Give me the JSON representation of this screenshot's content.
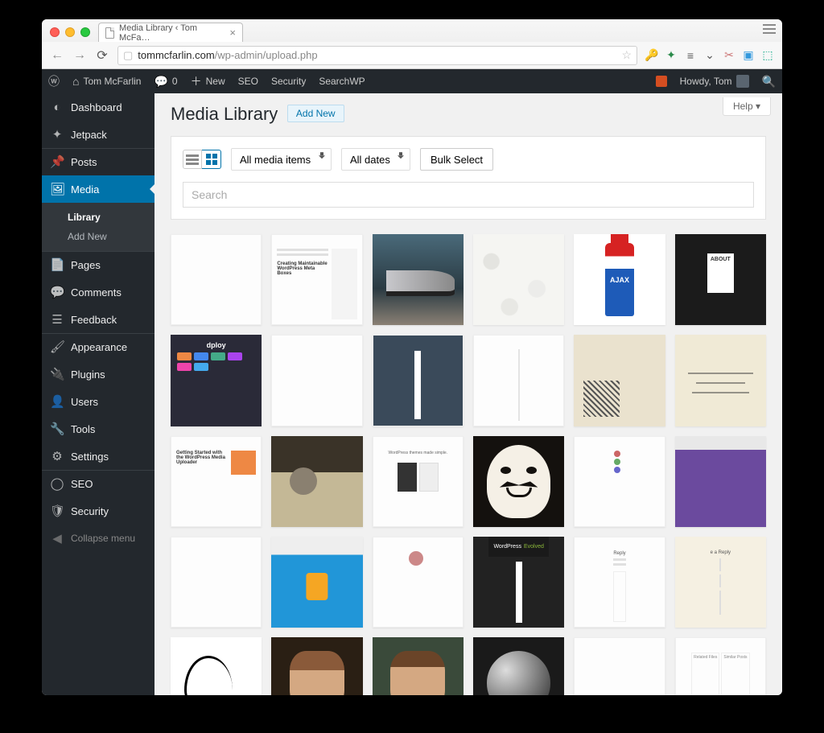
{
  "browser": {
    "tab_title": "Media Library ‹ Tom McFa…",
    "url_host": "tommcfarlin.com",
    "url_path": "/wp-admin/upload.php"
  },
  "adminbar": {
    "site_name": "Tom McFarlin",
    "comment_count": "0",
    "new_label": "New",
    "items": [
      "SEO",
      "Security",
      "SearchWP"
    ],
    "howdy": "Howdy, Tom"
  },
  "sidebar": {
    "items": [
      {
        "label": "Dashboard",
        "icon": "◐"
      },
      {
        "label": "Jetpack",
        "icon": "✦"
      },
      {
        "label": "Posts",
        "icon": "📌",
        "sep": true
      },
      {
        "label": "Media",
        "icon": "🖼",
        "current": true
      },
      {
        "label": "Pages",
        "icon": "📄",
        "sep": true
      },
      {
        "label": "Comments",
        "icon": "💬"
      },
      {
        "label": "Feedback",
        "icon": "☰"
      },
      {
        "label": "Appearance",
        "icon": "🖌",
        "sep": true
      },
      {
        "label": "Plugins",
        "icon": "🔌"
      },
      {
        "label": "Users",
        "icon": "👤"
      },
      {
        "label": "Tools",
        "icon": "🔧"
      },
      {
        "label": "Settings",
        "icon": "⚙"
      },
      {
        "label": "SEO",
        "icon": "◯",
        "sep": true
      },
      {
        "label": "Security",
        "icon": "🛡"
      }
    ],
    "submenu": {
      "library": "Library",
      "addnew": "Add New"
    },
    "collapse": "Collapse menu"
  },
  "page": {
    "title": "Media Library",
    "add_new": "Add New",
    "help": "Help",
    "filter_type": "All media items",
    "filter_date": "All dates",
    "bulk_select": "Bulk Select",
    "search_placeholder": "Search"
  }
}
